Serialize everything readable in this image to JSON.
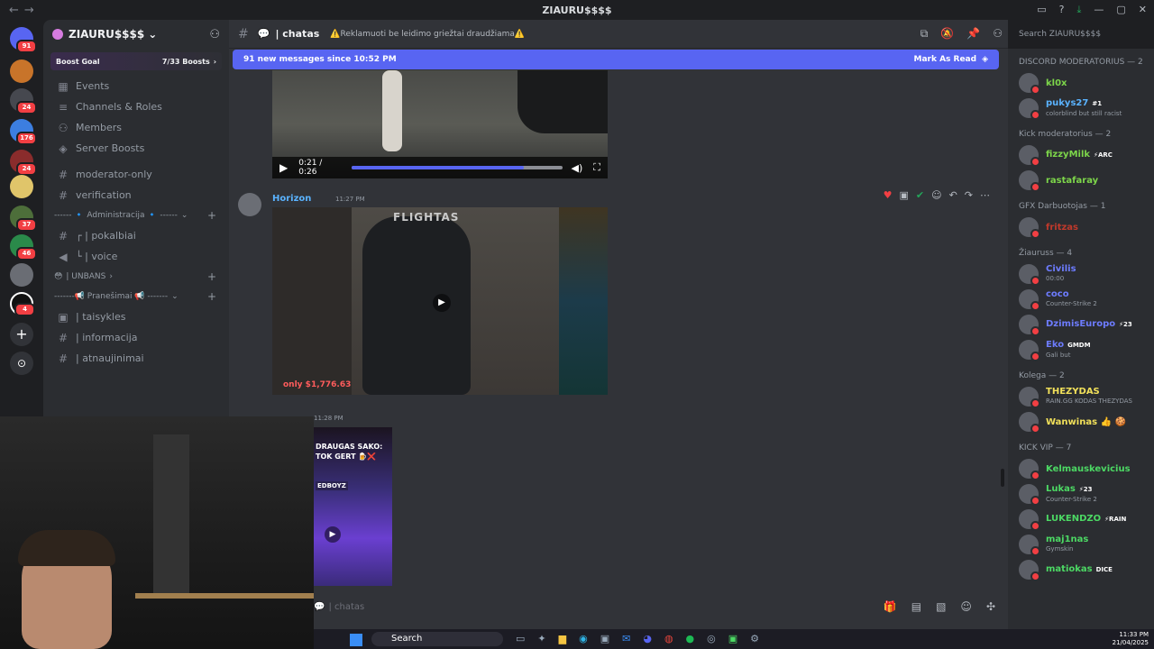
{
  "titlebar": {
    "title": "ZIAURU$$$$"
  },
  "server_rail": {
    "badges": [
      "91",
      "24",
      "176",
      "24",
      "37",
      "46",
      "4"
    ]
  },
  "sidebar": {
    "guild_name": "ZIAURU$$$$",
    "boost": {
      "label": "Boost Goal",
      "count": "7/33 Boosts"
    },
    "items": [
      {
        "label": "Events"
      },
      {
        "label": "Channels & Roles"
      },
      {
        "label": "Members"
      },
      {
        "label": "Server Boosts"
      }
    ],
    "channels": [
      {
        "label": "moderator-only"
      },
      {
        "label": "verification"
      }
    ],
    "category_admin": "------ 🔹 Administracija 🔹 ------",
    "admin_channels": [
      {
        "label": "┌ | pokalbiai"
      },
      {
        "label": "└ | voice"
      }
    ],
    "category_unbans": "| UNBANS",
    "category_pranesimai": "-------📢 Pranešimai 📢 -------",
    "pranesimai_channels": [
      {
        "label": "| taisykles"
      },
      {
        "label": "| informacija"
      },
      {
        "label": "| atnaujinimai"
      }
    ]
  },
  "channel_header": {
    "name": "| chatas",
    "topic": "⚠️Reklamuoti be leidimo griežtai draudžiama⚠️",
    "search_placeholder": "Search ZIAURU$$$$"
  },
  "new_messages_bar": {
    "text": "91 new messages since 10:52 PM",
    "action": "Mark As Read"
  },
  "video1": {
    "time": "0:21 / 0:26",
    "progress": 0.82
  },
  "message2": {
    "author": "Horizon",
    "time": "11:27 PM",
    "video_brand": "FLIGHTAS",
    "video_price": "only $1,776.63"
  },
  "message3": {
    "time": "11:28 PM",
    "video_text_1": "DRAUGAS SAKO:",
    "video_text_2": "TOK GERT",
    "video_text_3": "EDBOYZ"
  },
  "chat_input": {
    "placeholder": "| chatas"
  },
  "members": {
    "groups": [
      {
        "title": "DISCORD MODERATORIUS — 2",
        "members": [
          {
            "name": "kl0x",
            "color": "#7dd64a",
            "status": ""
          },
          {
            "name": "pukys27",
            "color": "#5ab3ff",
            "status": "colorblind but still racist",
            "tag": "#1"
          }
        ]
      },
      {
        "title": "Kick moderatorius — 2",
        "members": [
          {
            "name": "fizzyMilk",
            "color": "#7dd64a",
            "status": "",
            "tag": "⚡ARC"
          },
          {
            "name": "rastafaray",
            "color": "#7dd64a",
            "status": ""
          }
        ]
      },
      {
        "title": "GFX Darbuotojas — 1",
        "members": [
          {
            "name": "fritzas",
            "color": "#c0392b",
            "status": ""
          }
        ]
      },
      {
        "title": "Žiauruss — 4",
        "members": [
          {
            "name": "Civilis",
            "color": "#6d7cff",
            "status": "00:00"
          },
          {
            "name": "coco",
            "color": "#6d7cff",
            "status": "Counter-Strike 2"
          },
          {
            "name": "DzimisEuropo",
            "color": "#6d7cff",
            "status": "",
            "tag": "⚡23"
          },
          {
            "name": "Eko",
            "color": "#6d7cff",
            "status": "Gali but",
            "tag": "GMDM"
          }
        ]
      },
      {
        "title": "Kolega — 2",
        "members": [
          {
            "name": "THEZYDAS",
            "color": "#f1e05a",
            "status": "RAIN.GG KODAS THEZYDAS"
          },
          {
            "name": "Wanwinas 👍 🍪",
            "color": "#f1e05a",
            "status": ""
          }
        ]
      },
      {
        "title": "KICK VIP — 7",
        "members": [
          {
            "name": "Kelmauskevicius",
            "color": "#4cd964",
            "status": ""
          },
          {
            "name": "Lukas",
            "color": "#4cd964",
            "status": "Counter-Strike 2",
            "tag": "⚡23"
          },
          {
            "name": "LUKENDZO",
            "color": "#4cd964",
            "status": "",
            "tag": "⚡RAIN"
          },
          {
            "name": "maj1nas",
            "color": "#4cd964",
            "status": "Gymskin"
          },
          {
            "name": "matiokas",
            "color": "#4cd964",
            "status": "",
            "tag": "DICE"
          }
        ]
      }
    ]
  },
  "taskbar": {
    "search": "Search",
    "time": "11:33 PM",
    "date": "21/04/2025"
  }
}
